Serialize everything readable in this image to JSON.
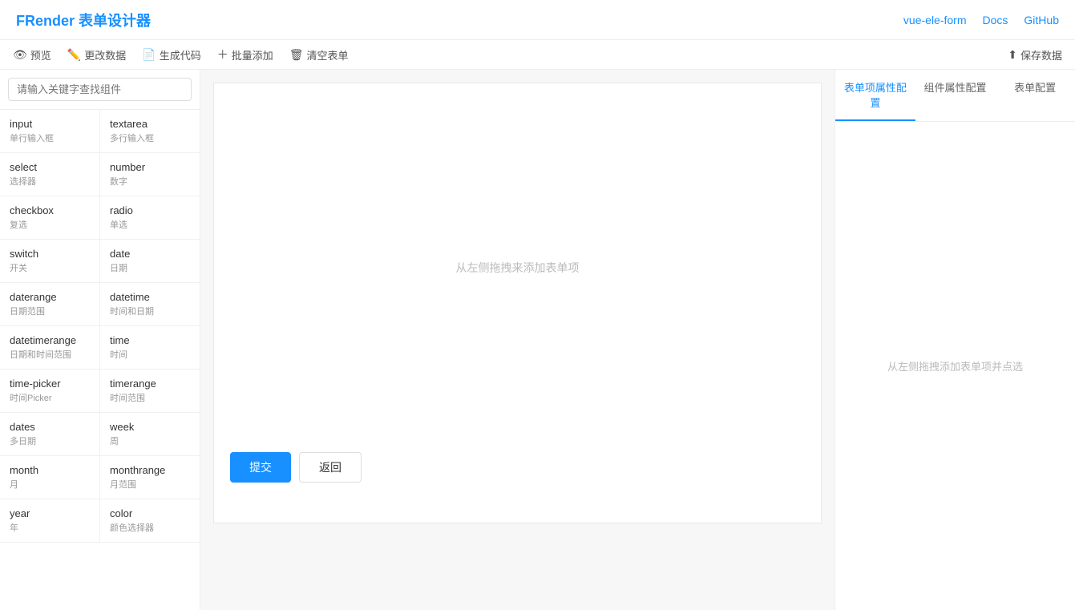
{
  "header": {
    "logo": "FRender 表单设计器",
    "links": [
      {
        "label": "vue-ele-form",
        "url": "#"
      },
      {
        "label": "Docs",
        "url": "#"
      },
      {
        "label": "GitHub",
        "url": "#"
      }
    ]
  },
  "toolbar": {
    "preview": "预览",
    "edit_data": "更改数据",
    "generate_code": "生成代码",
    "batch_add": "批量添加",
    "clear_form": "清空表单",
    "save_data": "保存数据"
  },
  "sidebar": {
    "search_placeholder": "请输入关键字查找组件",
    "items": [
      {
        "name": "input",
        "desc": "单行输入框"
      },
      {
        "name": "textarea",
        "desc": "多行输入框"
      },
      {
        "name": "select",
        "desc": "选择器"
      },
      {
        "name": "number",
        "desc": "数字"
      },
      {
        "name": "checkbox",
        "desc": "复选"
      },
      {
        "name": "radio",
        "desc": "单选"
      },
      {
        "name": "switch",
        "desc": "开关"
      },
      {
        "name": "date",
        "desc": "日期"
      },
      {
        "name": "daterange",
        "desc": "日期范围"
      },
      {
        "name": "datetime",
        "desc": "时间和日期"
      },
      {
        "name": "datetimerange",
        "desc": "日期和时间范围"
      },
      {
        "name": "time",
        "desc": "时间"
      },
      {
        "name": "time-picker",
        "desc": "时间Picker"
      },
      {
        "name": "timerange",
        "desc": "时间范围"
      },
      {
        "name": "dates",
        "desc": "多日期"
      },
      {
        "name": "week",
        "desc": "周"
      },
      {
        "name": "month",
        "desc": "月"
      },
      {
        "name": "monthrange",
        "desc": "月范围"
      },
      {
        "name": "year",
        "desc": "年"
      },
      {
        "name": "color",
        "desc": "颜色选择器"
      }
    ]
  },
  "canvas": {
    "placeholder": "从左侧拖拽来添加表单项",
    "submit_label": "提交",
    "back_label": "返回"
  },
  "right_panel": {
    "tabs": [
      {
        "label": "表单项属性配置",
        "active": true
      },
      {
        "label": "组件属性配置",
        "active": false
      },
      {
        "label": "表单配置",
        "active": false
      }
    ],
    "placeholder": "从左侧拖拽添加表单项并点选"
  }
}
